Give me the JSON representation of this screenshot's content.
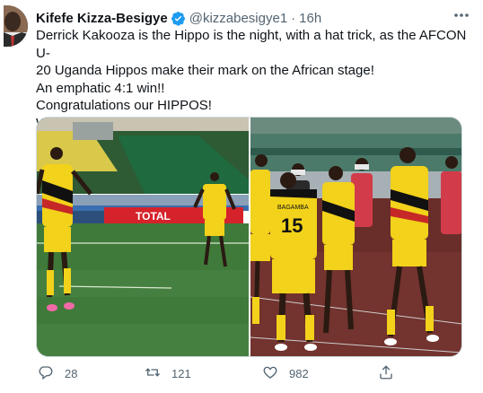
{
  "tweet": {
    "author_name": "Kifefe Kizza-Besigye",
    "handle": "@kizzabesigye1",
    "separator": "·",
    "time": "16h",
    "lines": [
      "Derrick Kakooza is the Hippo is the night, with a hat trick, as the AFCON U-",
      "20 Uganda Hippos make their mark on the African stage!",
      "An emphatic 4:1 win!!",
      "Congratulations our HIPPOS!",
      "We go, we go.. for the cup!"
    ],
    "media": {
      "left_ad_board_text": "TOTAL",
      "right_shirt_name": "BAGAMBA",
      "right_shirt_number": "15"
    },
    "stats": {
      "replies": "28",
      "retweets": "121",
      "likes": "982"
    }
  },
  "colors": {
    "verified_badge": "#1d9bf0",
    "secondary_text": "#536471",
    "jersey_yellow": "#f2d21a",
    "pitch_green": "#3f7a3a"
  },
  "icons": [
    "verified-badge-icon",
    "more-icon",
    "reply-icon",
    "retweet-icon",
    "like-icon",
    "share-icon"
  ]
}
